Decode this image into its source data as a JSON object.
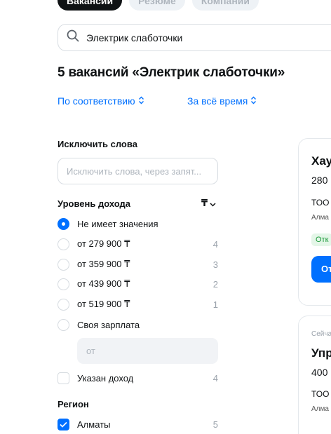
{
  "tabs": [
    {
      "label": "Вакансии",
      "active": true
    },
    {
      "label": "Резюме",
      "active": false
    },
    {
      "label": "Компании",
      "active": false
    }
  ],
  "search": {
    "value": "Электрик слаботочки",
    "icon": "search-icon"
  },
  "results_title": "5 вакансий «Электрик слаботочки»",
  "sort": {
    "relevance": "По соответствию",
    "period": "За всё время"
  },
  "filters": {
    "exclude": {
      "title": "Исключить слова",
      "placeholder": "Исключить слова, через запят..."
    },
    "income": {
      "title": "Уровень дохода",
      "currency": "₸",
      "options": [
        {
          "label": "Не имеет значения",
          "count": "",
          "selected": true
        },
        {
          "label": "от 279 900 ₸",
          "count": "4",
          "selected": false
        },
        {
          "label": "от 359 900 ₸",
          "count": "3",
          "selected": false
        },
        {
          "label": "от 439 900 ₸",
          "count": "2",
          "selected": false
        },
        {
          "label": "от 519 900 ₸",
          "count": "1",
          "selected": false
        },
        {
          "label": "Своя зарплата",
          "count": "",
          "selected": false
        }
      ],
      "custom_placeholder": "от",
      "specified": {
        "label": "Указан доход",
        "count": "4",
        "checked": false
      }
    },
    "region": {
      "title": "Регион",
      "items": [
        {
          "label": "Алматы",
          "count": "5",
          "checked": true
        }
      ]
    }
  },
  "cards": [
    {
      "title": "Хау",
      "salary": "280",
      "company": "ТОО",
      "city": "Алма",
      "badge": "Отк",
      "button": "От"
    },
    {
      "posted": "Сейча",
      "title": "Упр",
      "salary": "400",
      "company": "ТОО",
      "city": "Алма"
    }
  ],
  "colors": {
    "accent": "#0070ff",
    "text": "#0f1214",
    "muted": "#9aa2ab"
  }
}
